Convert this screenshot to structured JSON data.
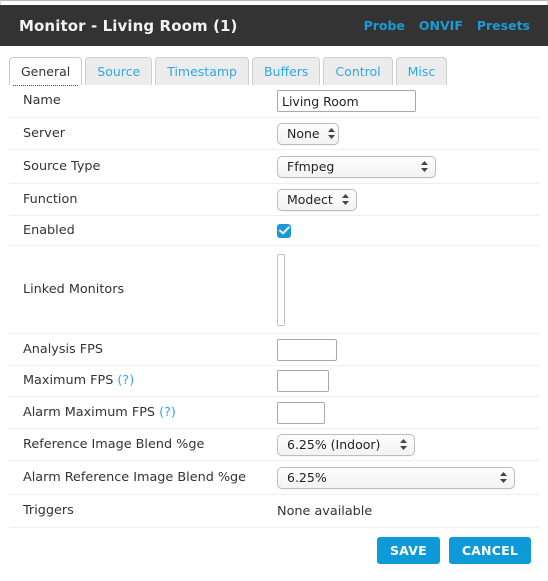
{
  "header": {
    "title": "Monitor - Living Room (1)",
    "links": [
      {
        "label": "Probe",
        "name": "probe-link"
      },
      {
        "label": "ONVIF",
        "name": "onvif-link"
      },
      {
        "label": "Presets",
        "name": "presets-link"
      }
    ]
  },
  "tabs": [
    {
      "label": "General",
      "active": true
    },
    {
      "label": "Source",
      "active": false
    },
    {
      "label": "Timestamp",
      "active": false
    },
    {
      "label": "Buffers",
      "active": false
    },
    {
      "label": "Control",
      "active": false
    },
    {
      "label": "Misc",
      "active": false
    }
  ],
  "form": {
    "name": {
      "label": "Name",
      "value": "Living Room",
      "placeholder": ""
    },
    "server": {
      "label": "Server",
      "value": "None"
    },
    "source_type": {
      "label": "Source Type",
      "value": "Ffmpeg"
    },
    "function": {
      "label": "Function",
      "value": "Modect"
    },
    "enabled": {
      "label": "Enabled",
      "checked": true
    },
    "linked_monitors": {
      "label": "Linked Monitors",
      "value": ""
    },
    "analysis_fps": {
      "label": "Analysis FPS",
      "value": "",
      "placeholder": ""
    },
    "maximum_fps": {
      "label": "Maximum FPS",
      "hint": "(?)",
      "value": "",
      "placeholder": ""
    },
    "alarm_maximum_fps": {
      "label": "Alarm Maximum FPS",
      "hint": "(?)",
      "value": "",
      "placeholder": ""
    },
    "reference_image_blend": {
      "label": "Reference Image Blend %ge",
      "value": "6.25% (Indoor)"
    },
    "alarm_reference_image_blend": {
      "label": "Alarm Reference Image Blend %ge",
      "value": "6.25%"
    },
    "triggers": {
      "label": "Triggers",
      "value": "None available"
    }
  },
  "footer": {
    "save_label": "SAVE",
    "cancel_label": "CANCEL"
  },
  "colors": {
    "header_bg": "#333333",
    "accent": "#0e9ad6",
    "link": "#1b9ad6",
    "tab_link": "#2fa8e0",
    "divider": "#efefef"
  }
}
